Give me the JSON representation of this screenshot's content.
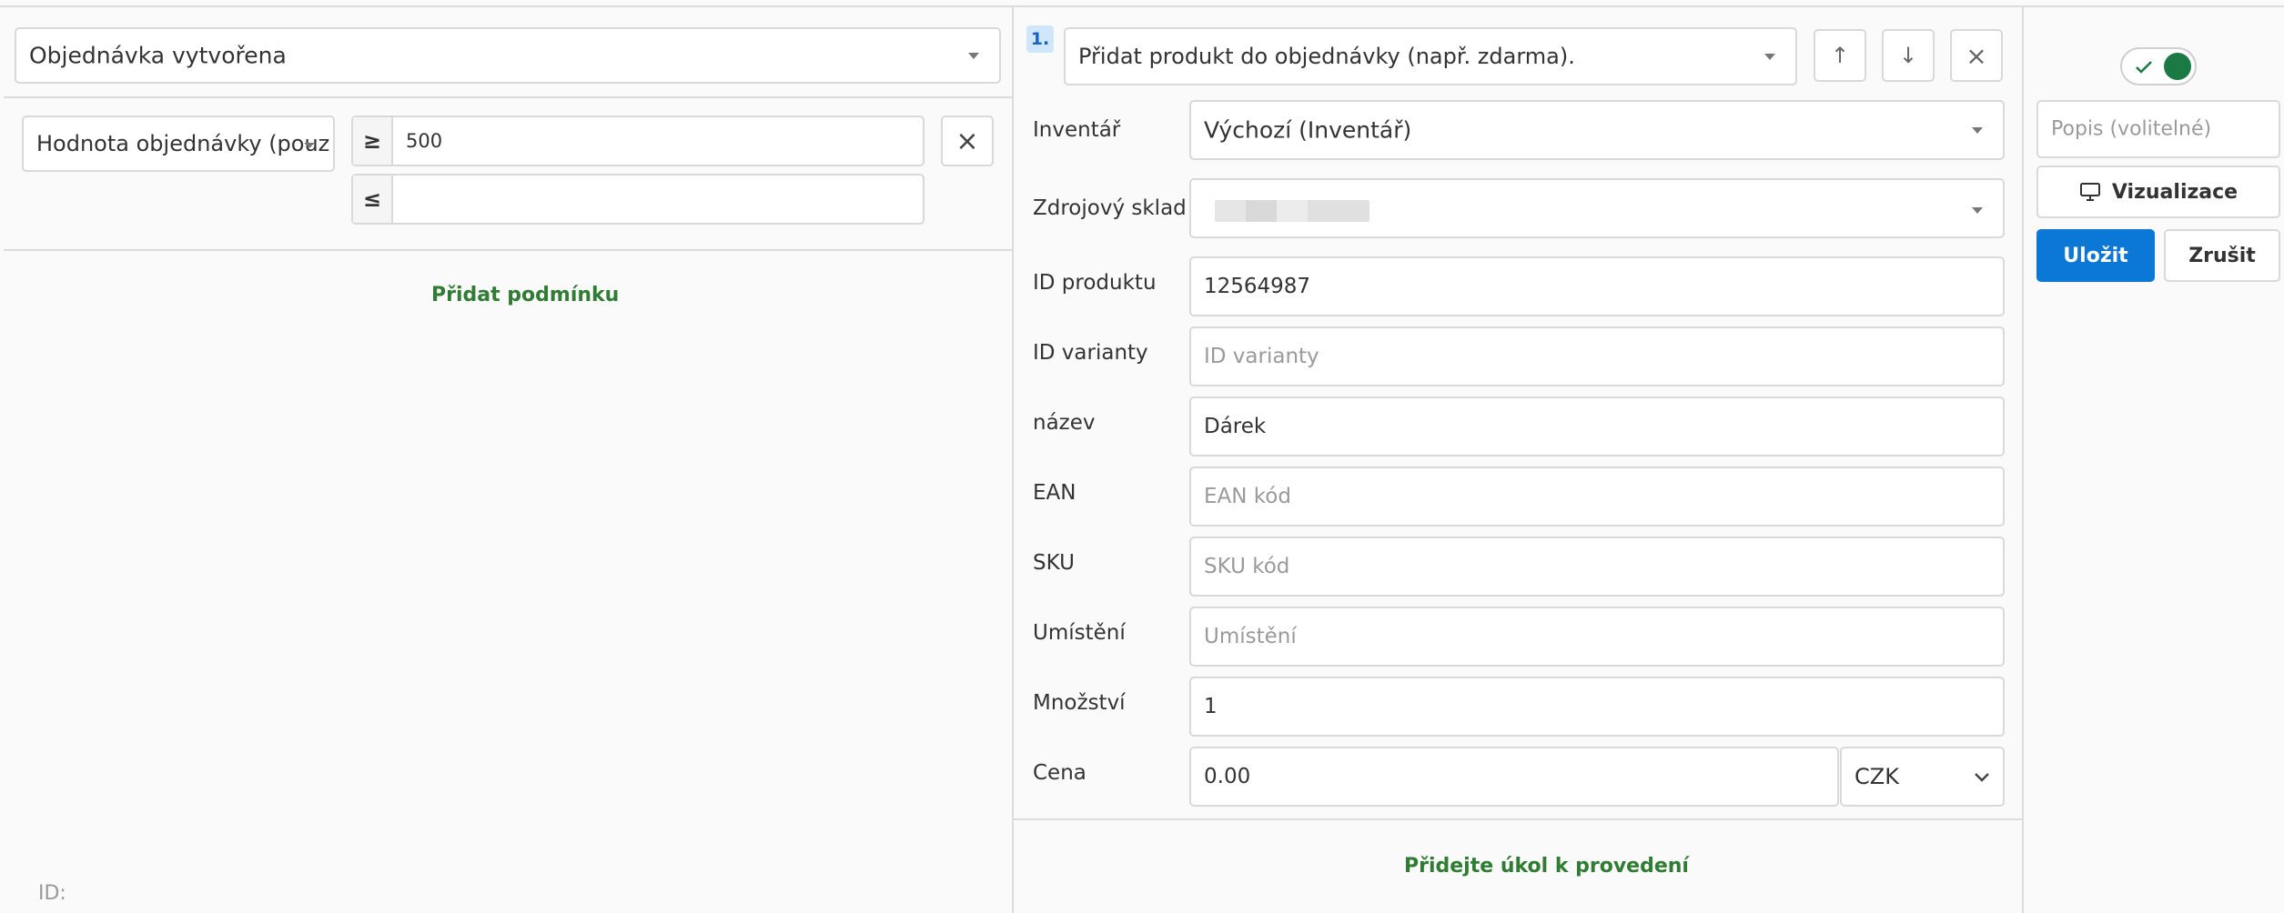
{
  "trigger": {
    "selected": "Objednávka vytvořena"
  },
  "condition": {
    "field": "Hodnota objednávky (pouz",
    "gte_symbol": "≥",
    "gte_value": "500",
    "lte_symbol": "≤",
    "lte_value": "",
    "remove_glyph": "×"
  },
  "add_condition_label": "Přidat podmínku",
  "footer_id_label": "ID:",
  "task": {
    "index_badge": "1.",
    "action_selected": "Přidat produkt do objednávky (např. zdarma).",
    "up_glyph": "↑",
    "down_glyph": "↓",
    "remove_glyph": "×",
    "fields": {
      "inventory": {
        "label": "Inventář",
        "value": "Výchozí (Inventář)"
      },
      "source_warehouse": {
        "label": "Zdrojový sklad",
        "value": ""
      },
      "product_id": {
        "label": "ID produktu",
        "value": "12564987"
      },
      "variant_id": {
        "label": "ID varianty",
        "placeholder": "ID varianty"
      },
      "name": {
        "label": "název",
        "value": "Dárek"
      },
      "ean": {
        "label": "EAN",
        "placeholder": "EAN kód"
      },
      "sku": {
        "label": "SKU",
        "placeholder": "SKU kód"
      },
      "location": {
        "label": "Umístění",
        "placeholder": "Umístění"
      },
      "quantity": {
        "label": "Množství",
        "value": "1"
      },
      "price": {
        "label": "Cena",
        "value": "0.00",
        "currency": "CZK"
      }
    }
  },
  "add_task_label": "Přidejte úkol k provedení",
  "sidebar": {
    "toggle_on": true,
    "description_placeholder": "Popis (volitelné)",
    "visualize_label": "Vizualizace",
    "save_label": "Uložit",
    "cancel_label": "Zrušit"
  },
  "colors": {
    "accent_blue": "#0b78d8",
    "toggle_green": "#1b7a43",
    "link_green": "#2e7d32",
    "badge_bg": "#cfe6fb"
  }
}
